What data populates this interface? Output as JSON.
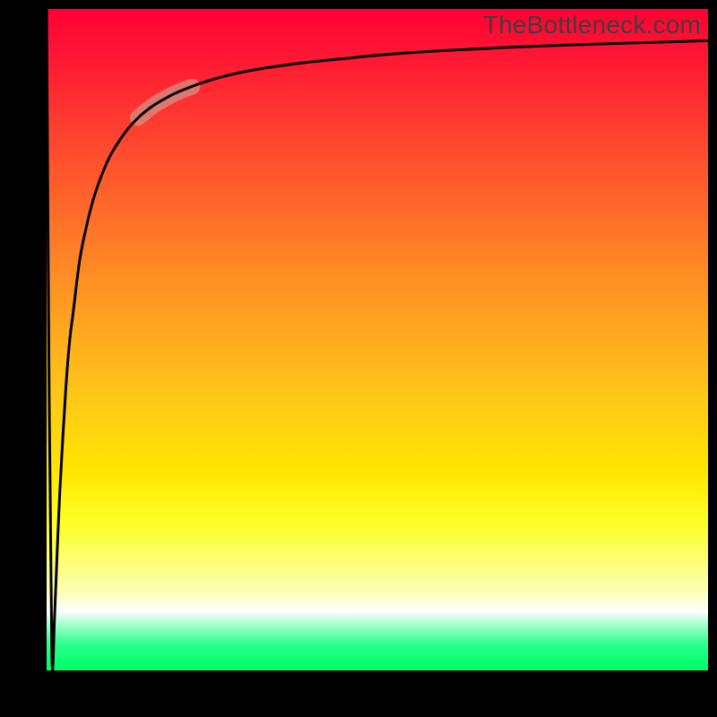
{
  "watermark": "TheBottleneck.com",
  "colors": {
    "frame": "#000000",
    "curve": "#000000",
    "highlight": "rgba(210,150,140,0.7)"
  },
  "chart_data": {
    "type": "line",
    "title": "",
    "xlabel": "",
    "ylabel": "",
    "xlim": [
      0,
      100
    ],
    "ylim": [
      0,
      100
    ],
    "grid": false,
    "legend": false,
    "series": [
      {
        "name": "curve",
        "x": [
          0,
          0.4,
          0.8,
          1.2,
          1.6,
          2.0,
          2.5,
          3.0,
          3.5,
          4.0,
          5.0,
          6.0,
          7.0,
          8.0,
          9.0,
          10.0,
          12.0,
          14.0,
          16.0,
          18.0,
          20.0,
          24.0,
          28.0,
          32.0,
          36.0,
          40.0,
          45.0,
          50.0,
          55.0,
          60.0,
          70.0,
          80.0,
          90.0,
          100.0
        ],
        "y": [
          100,
          40,
          2,
          8,
          18,
          27,
          36,
          44,
          50,
          54,
          62,
          67,
          71,
          74,
          76.5,
          78.5,
          81.5,
          83.7,
          85.3,
          86.5,
          87.5,
          89,
          90.1,
          90.9,
          91.5,
          92.0,
          92.5,
          93.0,
          93.4,
          93.7,
          94.2,
          94.6,
          94.9,
          95.2
        ],
        "note": "y is % from bottom of plot; estimated from gradient position of black curve"
      }
    ],
    "highlight_segment": {
      "x_range": [
        14,
        22
      ],
      "note": "thick translucent segment along the curve"
    }
  }
}
